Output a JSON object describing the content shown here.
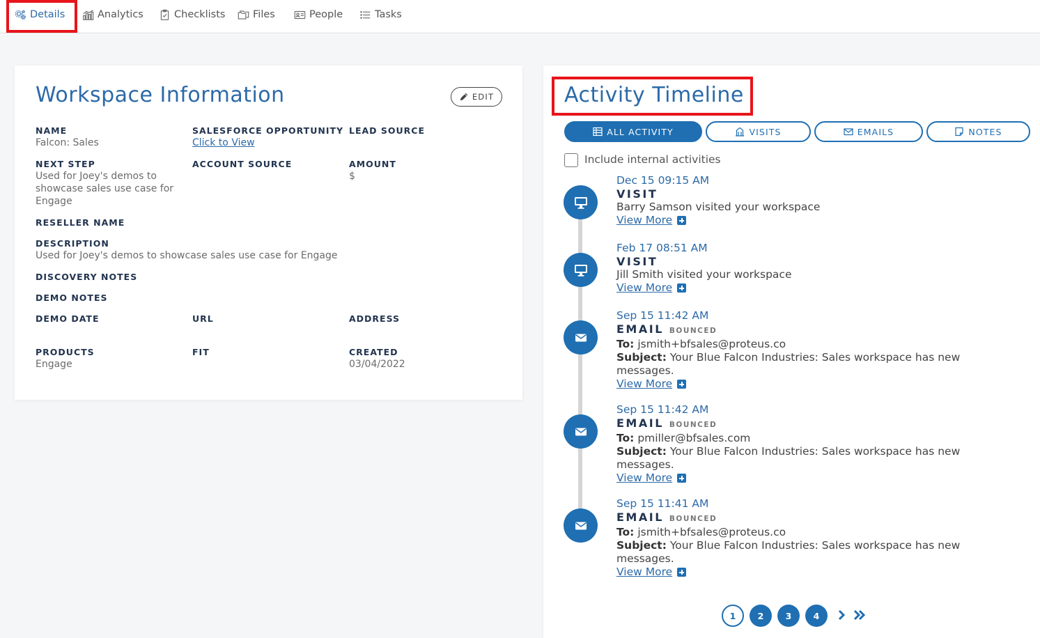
{
  "tabs": [
    {
      "label": "Details",
      "icon": "gears-icon",
      "active": true
    },
    {
      "label": "Analytics",
      "icon": "bar-chart-icon"
    },
    {
      "label": "Checklists",
      "icon": "clipboard-check-icon"
    },
    {
      "label": "Files",
      "icon": "folders-icon"
    },
    {
      "label": "People",
      "icon": "id-card-icon"
    },
    {
      "label": "Tasks",
      "icon": "list-icon"
    }
  ],
  "workspace": {
    "title": "Workspace Information",
    "edit_label": "EDIT",
    "fields": {
      "name": {
        "label": "NAME",
        "value": "Falcon: Sales"
      },
      "sf_opportunity": {
        "label": "SALESFORCE OPPORTUNITY",
        "value": "Click to View"
      },
      "lead_source": {
        "label": "LEAD SOURCE",
        "value": ""
      },
      "next_step": {
        "label": "NEXT STEP",
        "value": "Used for Joey's demos to showcase sales use case for Engage"
      },
      "account_source": {
        "label": "ACCOUNT SOURCE",
        "value": ""
      },
      "amount": {
        "label": "AMOUNT",
        "value": "$"
      },
      "reseller_name": {
        "label": "RESELLER NAME",
        "value": ""
      },
      "description": {
        "label": "DESCRIPTION",
        "value": "Used for Joey's demos to showcase sales use case for Engage"
      },
      "discovery_notes": {
        "label": "DISCOVERY NOTES",
        "value": ""
      },
      "demo_notes": {
        "label": "DEMO NOTES",
        "value": ""
      },
      "demo_date": {
        "label": "DEMO DATE",
        "value": ""
      },
      "url": {
        "label": "URL",
        "value": ""
      },
      "address": {
        "label": "ADDRESS",
        "value": ""
      },
      "products": {
        "label": "PRODUCTS",
        "value": "Engage"
      },
      "fit": {
        "label": "FIT",
        "value": ""
      },
      "created": {
        "label": "CREATED",
        "value": "03/04/2022"
      }
    }
  },
  "timeline": {
    "title": "Activity Timeline",
    "filters": [
      {
        "label": "ALL ACTIVITY",
        "icon": "table-icon",
        "active": true
      },
      {
        "label": "VISITS",
        "icon": "building-icon"
      },
      {
        "label": "EMAILS",
        "icon": "envelope-icon"
      },
      {
        "label": "NOTES",
        "icon": "note-icon"
      }
    ],
    "include_internal_label": "Include internal activities",
    "include_internal_checked": false,
    "to_label": "To:",
    "subject_label": "Subject:",
    "view_more_label": "View More",
    "entries": [
      {
        "date": "Dec 15 09:15 AM",
        "type": "VISIT",
        "badge": "",
        "text": "Barry Samson visited your workspace",
        "icon": "monitor-icon"
      },
      {
        "date": "Feb 17 08:51 AM",
        "type": "VISIT",
        "badge": "",
        "text": "Jill Smith visited your workspace",
        "icon": "monitor-icon"
      },
      {
        "date": "Sep 15 11:42 AM",
        "type": "EMAIL",
        "badge": "BOUNCED",
        "to": "jsmith+bfsales@proteus.co",
        "subject": "Your Blue Falcon Industries: Sales workspace has new messages.",
        "icon": "envelope-icon"
      },
      {
        "date": "Sep 15 11:42 AM",
        "type": "EMAIL",
        "badge": "BOUNCED",
        "to": "pmiller@bfsales.com",
        "subject": "Your Blue Falcon Industries: Sales workspace has new messages.",
        "icon": "envelope-icon"
      },
      {
        "date": "Sep 15 11:41 AM",
        "type": "EMAIL",
        "badge": "BOUNCED",
        "to": "jsmith+bfsales@proteus.co",
        "subject": "Your Blue Falcon Industries: Sales workspace has new messages.",
        "icon": "envelope-icon"
      }
    ]
  },
  "pagination": {
    "pages": [
      "1",
      "2",
      "3",
      "4"
    ],
    "current": "1",
    "next_icon": "chevron-right-icon",
    "last_icon": "double-chevron-right-icon"
  },
  "colors": {
    "accent": "#1f6fb2",
    "heading": "#2c6aa8",
    "highlight": "#e8141b"
  }
}
